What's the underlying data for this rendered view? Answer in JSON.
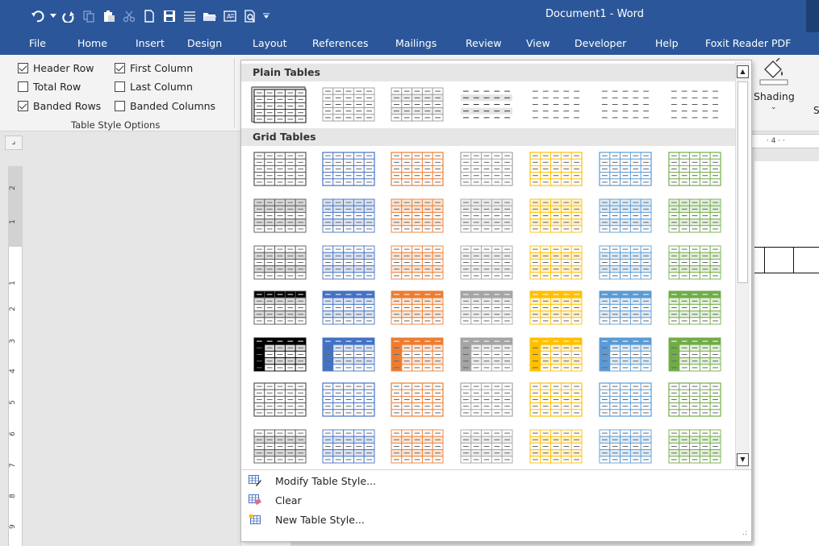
{
  "window": {
    "title": "Document1 - Word"
  },
  "quick_access": [
    "undo-icon",
    "redo-icon",
    "copy-icon",
    "paste-icon",
    "cut-icon",
    "new-document-icon",
    "save-icon",
    "align-icon",
    "open-icon",
    "text-box-icon",
    "print-preview-icon",
    "customize-icon"
  ],
  "tabs": [
    "File",
    "Home",
    "Insert",
    "Design",
    "Layout",
    "References",
    "Mailings",
    "Review",
    "View",
    "Developer",
    "Help",
    "Foxit Reader PDF"
  ],
  "table_style_options": {
    "group_label": "Table Style Options",
    "options": [
      {
        "label": "Header Row",
        "checked": true
      },
      {
        "label": "First Column",
        "checked": true
      },
      {
        "label": "Total Row",
        "checked": false
      },
      {
        "label": "Last Column",
        "checked": false
      },
      {
        "label": "Banded Rows",
        "checked": true
      },
      {
        "label": "Banded Columns",
        "checked": false
      }
    ]
  },
  "shading": {
    "label": "Shading",
    "cut_label": "S"
  },
  "ruler": {
    "corner": "⌟",
    "vertical_numbers": [
      "2",
      "1",
      "1",
      "2",
      "3",
      "4",
      "5",
      "6",
      "7",
      "8",
      "9"
    ],
    "horizontal_text": "· 4 · ·"
  },
  "gallery": {
    "sections": [
      {
        "title": "Plain Tables"
      },
      {
        "title": "Grid Tables"
      }
    ],
    "colors": [
      "#000000",
      "#4472c4",
      "#ed7d31",
      "#a5a5a5",
      "#ffc000",
      "#5b9bd5",
      "#70ad47"
    ],
    "light_colors": [
      "#d9d9d9",
      "#dae3f3",
      "#fbe5d6",
      "#ededed",
      "#fff2cc",
      "#deebf7",
      "#e2f0d9"
    ],
    "menu": [
      {
        "label": "Modify Table Style...",
        "icon": "modify-table-style-icon"
      },
      {
        "label": "Clear",
        "icon": "clear-table-style-icon"
      },
      {
        "label": "New Table Style...",
        "icon": "new-table-style-icon"
      }
    ],
    "resize_grip": ".:"
  }
}
